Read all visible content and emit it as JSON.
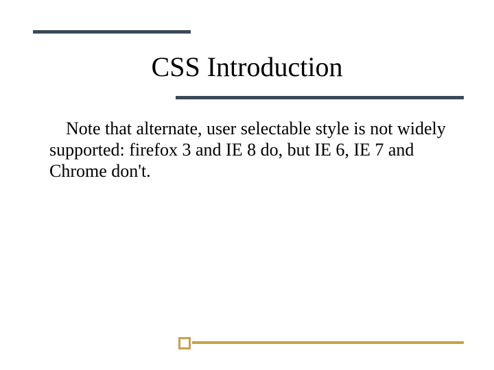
{
  "slide": {
    "title": "CSS Introduction",
    "body": "Note that alternate, user selectable style is not widely supported: firefox 3 and IE 8 do, but IE 6, IE 7 and Chrome don't."
  },
  "colors": {
    "line_dark": "#3a4a5a",
    "line_accent": "#c6a24a"
  }
}
